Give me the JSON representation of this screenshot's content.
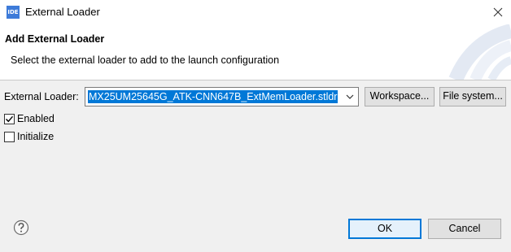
{
  "window": {
    "app_icon_text": "IDE",
    "title": "External Loader",
    "close_icon": "close-icon"
  },
  "banner": {
    "title": "Add External Loader",
    "description": "Select the external loader to add to the launch configuration"
  },
  "loader": {
    "label": "External Loader:",
    "selected_value": "MX25UM25645G_ATK-CNN647B_ExtMemLoader.stldr",
    "dropdown_icon": "chevron-down-icon",
    "workspace_button": "Workspace...",
    "filesystem_button": "File system..."
  },
  "options": {
    "enabled_label": "Enabled",
    "enabled_checked": true,
    "initialize_label": "Initialize",
    "initialize_checked": false
  },
  "footer": {
    "help_icon": "help-icon",
    "ok_label": "OK",
    "cancel_label": "Cancel"
  },
  "colors": {
    "accent": "#0078d7",
    "background": "#f0f0f0",
    "banner_background": "#ffffff"
  }
}
